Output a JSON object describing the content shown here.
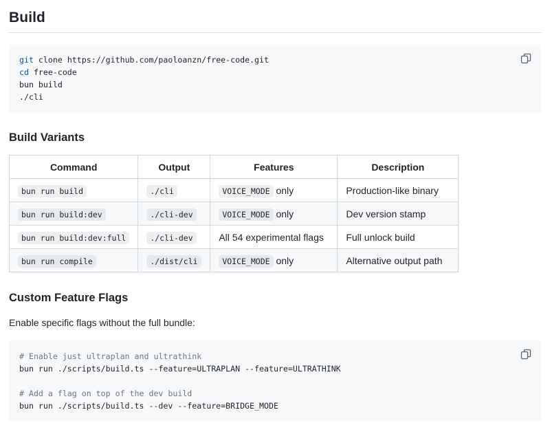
{
  "build_heading": "Build",
  "build_code": {
    "lines": [
      {
        "cmd": "git",
        "rest": " clone https://github.com/paoloanzn/free-code.git"
      },
      {
        "cmd": "cd",
        "rest": " free-code"
      },
      {
        "cmd": "",
        "rest": "bun build"
      },
      {
        "cmd": "",
        "rest": "./cli"
      }
    ],
    "copy_icon": "copy-icon"
  },
  "variants_heading": "Build Variants",
  "variants_table": {
    "headers": [
      "Command",
      "Output",
      "Features",
      "Description"
    ],
    "rows": [
      {
        "command": "bun run build",
        "output": "./cli",
        "feature_code": "VOICE_MODE",
        "feature_text": " only",
        "description": "Production-like binary"
      },
      {
        "command": "bun run build:dev",
        "output": "./cli-dev",
        "feature_code": "VOICE_MODE",
        "feature_text": " only",
        "description": "Dev version stamp"
      },
      {
        "command": "bun run build:dev:full",
        "output": "./cli-dev",
        "feature_code": "",
        "feature_text": "All 54 experimental flags",
        "description": "Full unlock build"
      },
      {
        "command": "bun run compile",
        "output": "./dist/cli",
        "feature_code": "VOICE_MODE",
        "feature_text": " only",
        "description": "Alternative output path"
      }
    ]
  },
  "flags_heading": "Custom Feature Flags",
  "flags_paragraph": "Enable specific flags without the full bundle:",
  "flags_code": {
    "lines": [
      {
        "type": "comment",
        "text": "# Enable just ultraplan and ultrathink"
      },
      {
        "type": "code",
        "text": "bun run ./scripts/build.ts --feature=ULTRAPLAN --feature=ULTRATHINK"
      },
      {
        "type": "blank",
        "text": ""
      },
      {
        "type": "comment",
        "text": "# Add a flag on top of the dev build"
      },
      {
        "type": "code",
        "text": "bun run ./scripts/build.ts --dev --feature=BRIDGE_MODE"
      }
    ],
    "copy_icon": "copy-icon"
  },
  "colors": {
    "text": "#1f2328",
    "code_bg": "#f6f8fa",
    "keyword": "#0550ae",
    "comment": "#6e7781",
    "border": "#d0d7de"
  }
}
